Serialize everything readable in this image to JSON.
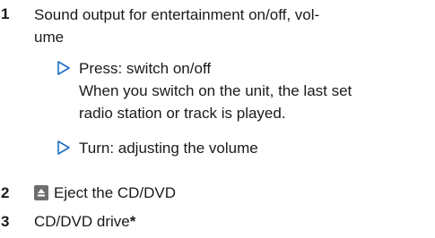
{
  "items": [
    {
      "number": "1",
      "lines": [
        "Sound output for entertainment on/off, vol-",
        "ume"
      ],
      "subitems": [
        {
          "lines": [
            "Press: switch on/off",
            "When you switch on the unit, the last set",
            "radio station or track is played."
          ],
          "marker_icon": "triangle-right-icon"
        },
        {
          "lines": [
            "Turn: adjusting the volume"
          ],
          "marker_icon": "triangle-right-icon"
        }
      ]
    },
    {
      "number": "2",
      "icon": "eject-icon",
      "text": "Eject the CD/DVD"
    },
    {
      "number": "3",
      "text": "CD/DVD drive",
      "marker": "*"
    }
  ],
  "colors": {
    "text": "#1a1a1a",
    "accent": "#1f6fc5",
    "icon_background": "#6d6d6d"
  }
}
